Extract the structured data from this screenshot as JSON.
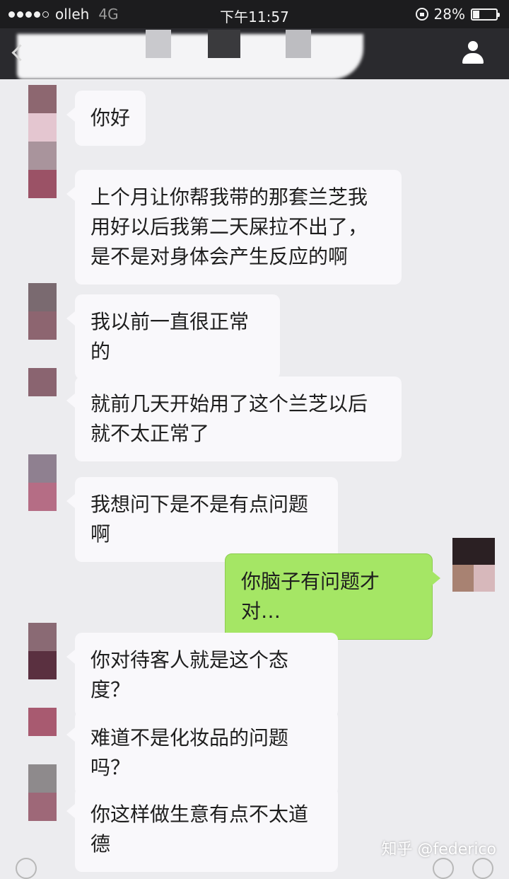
{
  "status_bar": {
    "carrier": "olleh",
    "network": "4G",
    "time": "下午11:57",
    "battery_text": "28%",
    "battery_level": 0.28
  },
  "nav": {
    "back_icon": "chevron-left-icon",
    "profile_icon": "person-icon"
  },
  "messages": [
    {
      "side": "in",
      "text": "你好"
    },
    {
      "side": "in",
      "text": "上个月让你帮我带的那套兰芝我用好以后我第二天屎拉不出了，是不是对身体会产生反应的啊"
    },
    {
      "side": "in",
      "text": "我以前一直很正常的"
    },
    {
      "side": "in",
      "text": "就前几天开始用了这个兰芝以后就不太正常了"
    },
    {
      "side": "in",
      "text": "我想问下是不是有点问题啊"
    },
    {
      "side": "out",
      "text": "你脑子有问题才对…"
    },
    {
      "side": "in",
      "text": "你对待客人就是这个态度？"
    },
    {
      "side": "in",
      "text": "难道不是化妆品的问题吗？"
    },
    {
      "side": "in",
      "text": "你这样做生意有点不太道德"
    }
  ],
  "watermark": "知乎 @federico",
  "colors": {
    "outgoing_bubble": "#a5e665",
    "incoming_bubble": "#f9f8fb",
    "chat_background": "#ececef",
    "nav_background": "#2a2a2e"
  }
}
